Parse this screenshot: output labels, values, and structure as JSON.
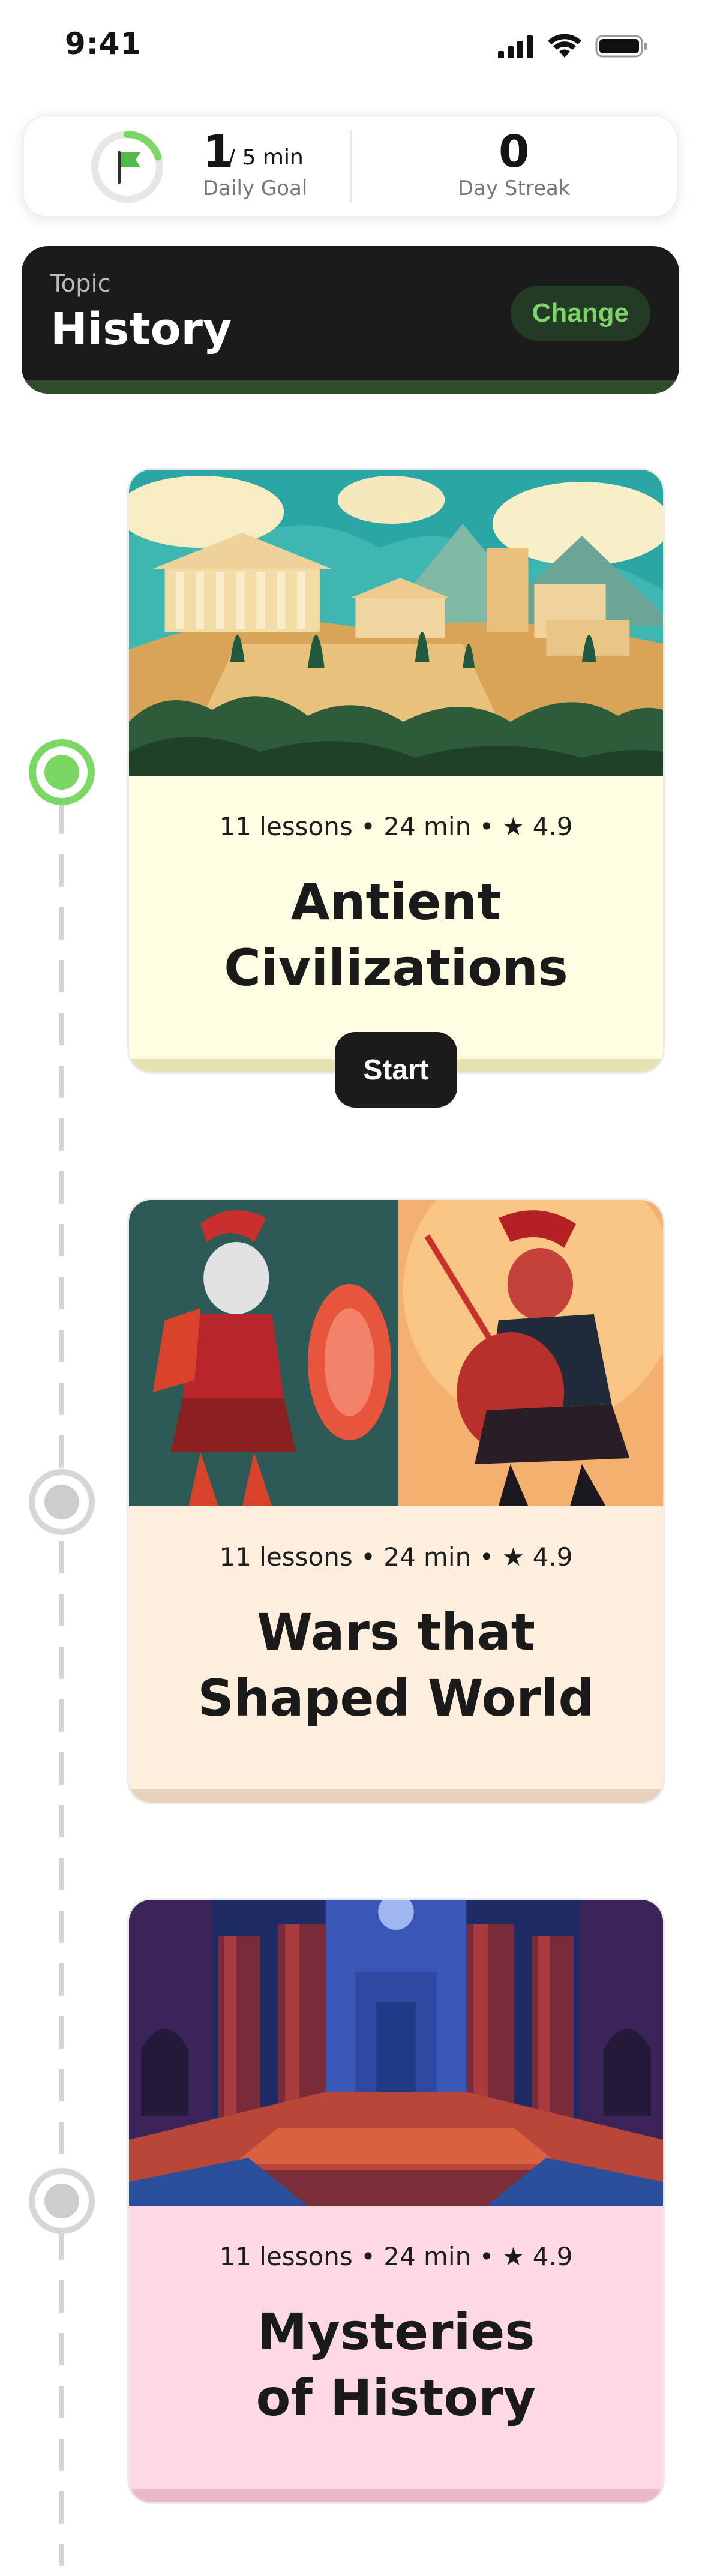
{
  "status_bar": {
    "time": "9:41"
  },
  "daily_goal": {
    "current": "1",
    "unit": "/ 5 min",
    "label": "Daily Goal",
    "progress_fraction": 0.2,
    "ring_color": "#7bd864"
  },
  "day_streak": {
    "value": "0",
    "label": "Day Streak"
  },
  "topic": {
    "label": "Topic",
    "title": "History",
    "change_label": "Change"
  },
  "courses": [
    {
      "meta": "11 lessons • 24 min •",
      "rating": "4.9",
      "title_line1": "Antient",
      "title_line2": "Civilizations",
      "bg": "#fdfde2",
      "accent": "#e4e1b3",
      "status": "active",
      "illustration": "ancient-greek-city-illustration"
    },
    {
      "meta": "11 lessons • 24 min •",
      "rating": "4.9",
      "title_line1": "Wars that",
      "title_line2": "Shaped World",
      "bg": "#fdeedd",
      "accent": "#e9d2bc",
      "status": "locked",
      "illustration": "spartan-warriors-illustration"
    },
    {
      "meta": "11 lessons • 24 min •",
      "rating": "4.9",
      "title_line1": "Mysteries",
      "title_line2": "of History",
      "bg": "#fcd9e3",
      "accent": "#e8b9c6",
      "status": "locked",
      "illustration": "temple-ruins-illustration"
    }
  ],
  "start_label": "Start"
}
